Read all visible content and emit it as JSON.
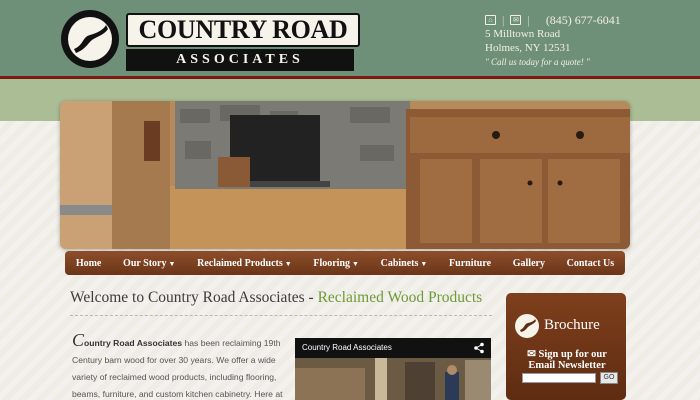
{
  "header": {
    "brand": "COUNTRY ROAD",
    "brand_sub": "ASSOCIATES",
    "phone": "(845) 677-6041",
    "address_line1": "5 Milltown Road",
    "address_line2": "Holmes, NY 12531",
    "tagline": "\" Call us today for a quote! \""
  },
  "nav": {
    "items": [
      {
        "label": "Home",
        "dropdown": false
      },
      {
        "label": "Our Story",
        "dropdown": true
      },
      {
        "label": "Reclaimed Products",
        "dropdown": true
      },
      {
        "label": "Flooring",
        "dropdown": true
      },
      {
        "label": "Cabinets",
        "dropdown": true
      },
      {
        "label": "Furniture",
        "dropdown": false
      },
      {
        "label": "Gallery",
        "dropdown": false
      },
      {
        "label": "Contact Us",
        "dropdown": false
      }
    ]
  },
  "main": {
    "welcome_prefix": "Welcome to Country Road Associates - ",
    "welcome_accent": "Reclaimed Wood Products",
    "intro_dropcap": "C",
    "intro_bold": "ountry Road Associates",
    "intro_rest": " has been reclaiming 19th Century barn wood for over 30 years. We offer a wide variety of reclaimed wood products, including flooring, beams, furniture, and custom kitchen cabinetry. Here at",
    "video_title": "Country Road Associates"
  },
  "sidebar": {
    "brochure_title": "Brochure",
    "signup_line1": "Sign up for our",
    "signup_line2": "Email Newsletter",
    "email_placeholder": "",
    "go_label": "GO"
  },
  "colors": {
    "header_green": "#6f9078",
    "band_green": "#aabd94",
    "nav_brown": "#7a3f1f",
    "accent_green": "#6d9a38"
  },
  "icons": [
    "saw-blade-logo-icon",
    "home-icon",
    "mail-icon",
    "share-icon",
    "brochure-logo-icon",
    "envelope-icon"
  ]
}
